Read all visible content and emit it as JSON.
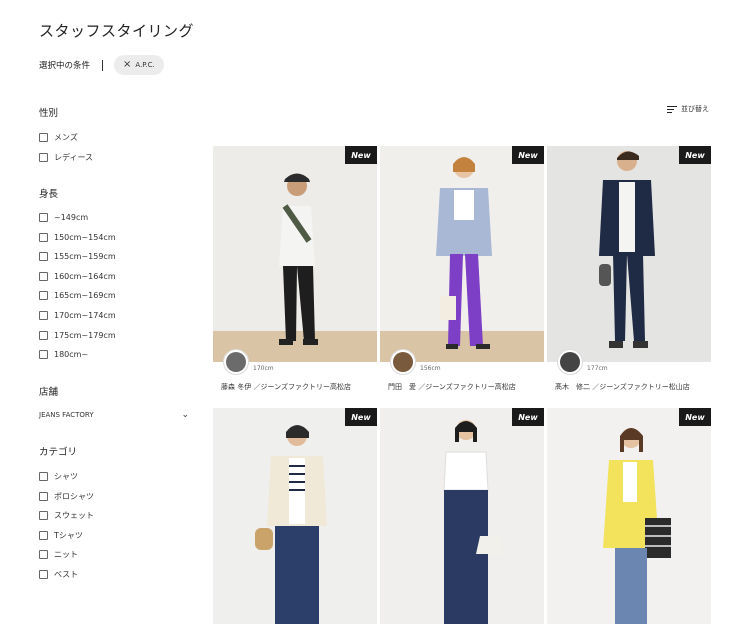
{
  "page": {
    "title": "スタッフスタイリング"
  },
  "conditions": {
    "label": "選択中の条件",
    "chip": "A.P.C."
  },
  "sort": {
    "label": "並び替え"
  },
  "sidebar": {
    "gender": {
      "title": "性別",
      "options": [
        "メンズ",
        "レディース"
      ]
    },
    "height": {
      "title": "身長",
      "options": [
        "~149cm",
        "150cm~154cm",
        "155cm~159cm",
        "160cm~164cm",
        "165cm~169cm",
        "170cm~174cm",
        "175cm~179cm",
        "180cm~"
      ]
    },
    "store": {
      "title": "店舗",
      "selected": "JEANS FACTORY"
    },
    "category": {
      "title": "カテゴリ",
      "options": [
        "シャツ",
        "ポロシャツ",
        "スウェット",
        "Tシャツ",
        "ニット",
        "ベスト"
      ]
    }
  },
  "cards": [
    {
      "badge": "New",
      "height": "170cm",
      "staff": "藤森 冬伊 ／ジーンズファクトリー高松店"
    },
    {
      "badge": "New",
      "height": "156cm",
      "staff": "門田　愛 ／ジーンズファクトリー高松店"
    },
    {
      "badge": "New",
      "height": "177cm",
      "staff": "髙木　修二 ／ジーンズファクトリー松山店"
    },
    {
      "badge": "New"
    },
    {
      "badge": "New"
    },
    {
      "badge": "New"
    }
  ]
}
